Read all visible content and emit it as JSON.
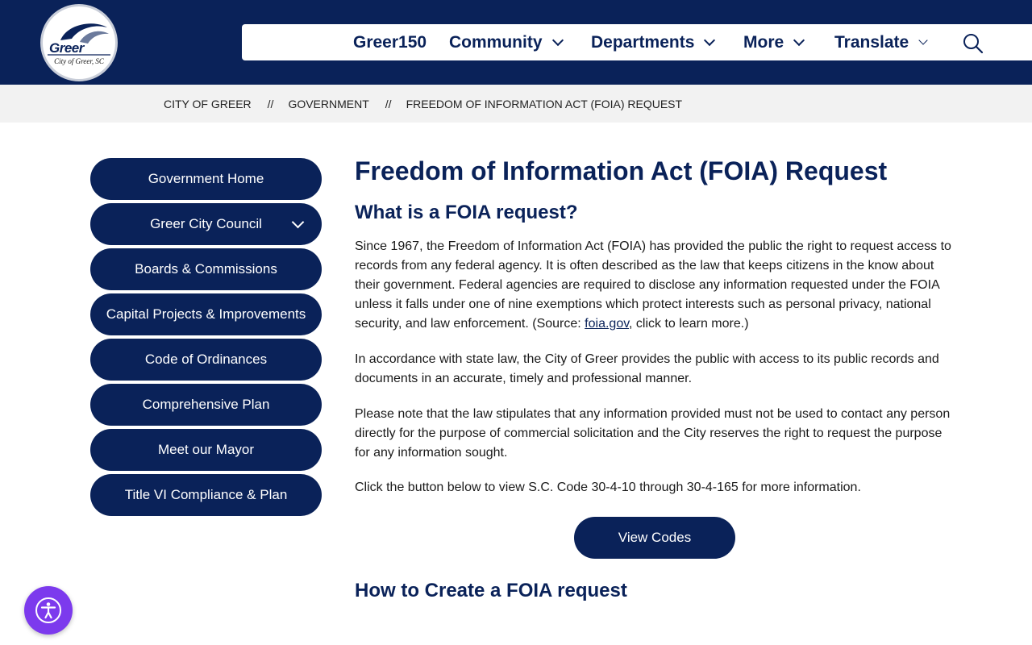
{
  "logo": {
    "wordmark": "Greer",
    "city_line": "City of Greer, SC",
    "colors": {
      "navy": "#0a2259"
    }
  },
  "nav": {
    "items": [
      {
        "label": "Greer150",
        "has_dropdown": false
      },
      {
        "label": "Community",
        "has_dropdown": true
      },
      {
        "label": "Departments",
        "has_dropdown": true
      },
      {
        "label": "More",
        "has_dropdown": true
      },
      {
        "label": "Translate",
        "has_dropdown": true
      }
    ],
    "search_icon": "search-icon"
  },
  "breadcrumb": {
    "items": [
      "CITY OF GREER",
      "GOVERNMENT",
      "FREEDOM OF INFORMATION ACT (FOIA) REQUEST"
    ],
    "separator": "//"
  },
  "sidebar": {
    "items": [
      {
        "label": "Government Home"
      },
      {
        "label": "Greer City Council",
        "has_dropdown": true
      },
      {
        "label": "Boards & Commissions"
      },
      {
        "label": "Capital Projects & Improvements"
      },
      {
        "label": "Code of Ordinances"
      },
      {
        "label": "Comprehensive Plan"
      },
      {
        "label": "Meet our Mayor"
      },
      {
        "label": "Title VI Compliance & Plan"
      }
    ]
  },
  "main": {
    "title": "Freedom of Information Act (FOIA) Request",
    "section1_heading": "What is a FOIA request?",
    "p1_before_link": "Since 1967, the Freedom of Information Act (FOIA) has provided the public the right to request access to records from any federal agency. It is often described as the law that keeps citizens in the know about their government. Federal agencies are required to disclose any information requested under the FOIA unless it falls under one of nine exemptions which protect interests such as personal privacy, national security, and law enforcement. (Source: ",
    "p1_link": "foia.gov",
    "p1_after_link": ", click to learn more.)",
    "p2": "In accordance with state law, the City of Greer provides the public with access to its public records and documents in an accurate, timely and professional manner.",
    "p3": "Please note that the law stipulates that any information provided must not be used to contact any person directly for the purpose of commercial solicitation and the City reserves the right to request the purpose for any information sought.",
    "p4": "Click the button below to view S.C. Code 30-4-10 through 30-4-165 for more information.",
    "view_codes_label": "View Codes",
    "section2_heading": "How to Create a FOIA request"
  },
  "accessibility_widget": {
    "icon": "accessibility-icon",
    "color": "#7c3aed"
  }
}
